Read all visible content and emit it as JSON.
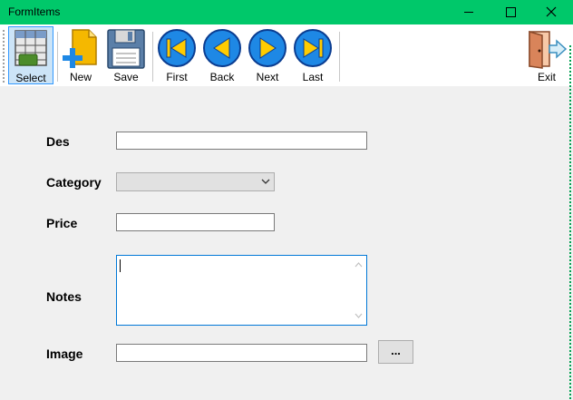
{
  "window": {
    "title": "FormItems"
  },
  "toolbar": {
    "select_label": "Select",
    "new_label": "New",
    "save_label": "Save",
    "first_label": "First",
    "back_label": "Back",
    "next_label": "Next",
    "last_label": "Last",
    "exit_label": "Exit"
  },
  "form": {
    "des_label": "Des",
    "des_value": "",
    "category_label": "Category",
    "category_value": "",
    "price_label": "Price",
    "price_value": "",
    "notes_label": "Notes",
    "notes_value": "",
    "image_label": "Image",
    "image_value": "",
    "browse_label": "..."
  },
  "colors": {
    "titlebar": "#00c86a",
    "accent": "#0078d7",
    "nav_button": "#1e88e5",
    "nav_arrow": "#ffcc00"
  }
}
